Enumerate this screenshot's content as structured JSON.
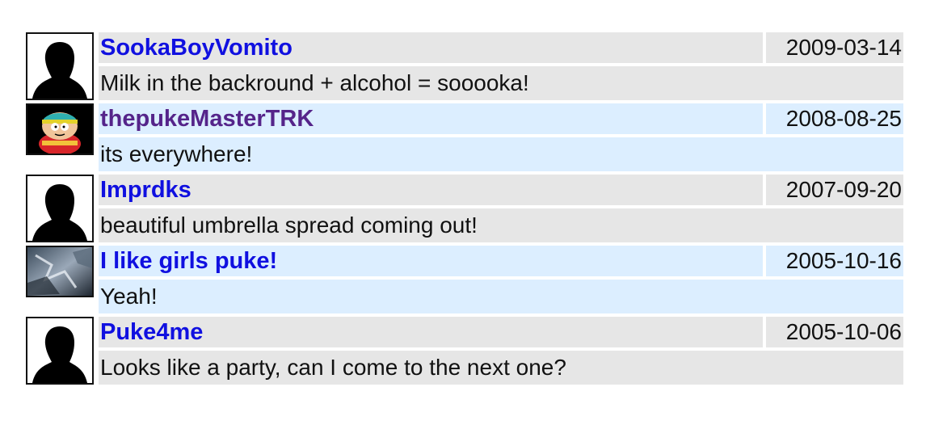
{
  "comments": [
    {
      "username": "SookaBoyVomito",
      "date": "2009-03-14",
      "text": "Milk in the backround + alcohol = sooooka!",
      "avatar": "silhouette-avatar-icon"
    },
    {
      "username": "thepukeMasterTRK",
      "date": "2008-08-25",
      "text": "its everywhere!",
      "avatar": "cartoon-character-avatar-icon"
    },
    {
      "username": "Imprdks",
      "date": "2007-09-20",
      "text": "beautiful umbrella spread coming out!",
      "avatar": "silhouette-avatar-icon"
    },
    {
      "username": "I like girls puke!",
      "date": "2005-10-16",
      "text": "Yeah!",
      "avatar": "photo-avatar-icon"
    },
    {
      "username": "Puke4me",
      "date": "2005-10-06",
      "text": "Looks like a party, can I come to the next one?",
      "avatar": "silhouette-avatar-icon"
    }
  ],
  "colors": {
    "link": "#1010e0",
    "visited_link": "#55248a",
    "row_gray": "#e6e6e6",
    "row_blue": "#dceeff"
  }
}
